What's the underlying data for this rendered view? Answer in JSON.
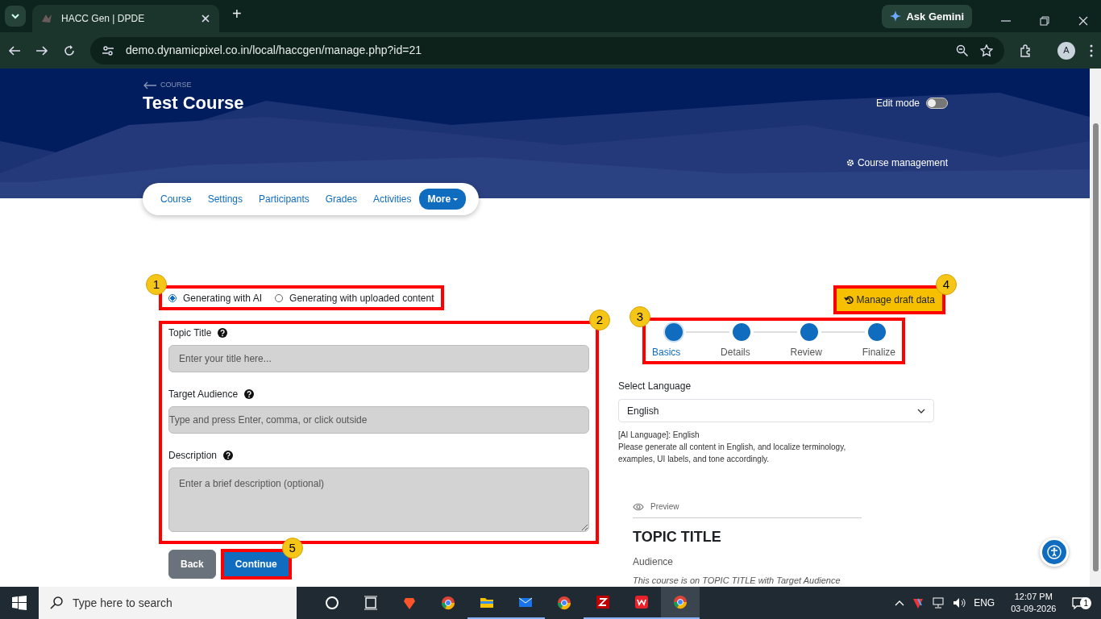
{
  "browser": {
    "tab_title": "HACC Gen | DPDE",
    "new_tab": "+",
    "ask_gemini": "Ask Gemini",
    "url": "demo.dynamicpixel.co.in/local/haccgen/manage.php?id=21",
    "profile": "A"
  },
  "header": {
    "back_label": "COURSE",
    "title": "Test Course",
    "edit_mode": {
      "label": "Edit mode",
      "on": false
    },
    "course_management": "Course management"
  },
  "course_nav": [
    {
      "label": "Course",
      "selected": false
    },
    {
      "label": "Settings",
      "selected": false
    },
    {
      "label": "Participants",
      "selected": false
    },
    {
      "label": "Grades",
      "selected": false
    },
    {
      "label": "Activities",
      "selected": false
    },
    {
      "label": "More",
      "selected": true
    }
  ],
  "mode_options": {
    "annotation": {
      "number": "1"
    },
    "items": [
      {
        "label": "Generating with AI",
        "selected": true
      },
      {
        "label": "Generating with uploaded content",
        "selected": false
      }
    ]
  },
  "form": {
    "annotation": {
      "number": "2"
    },
    "fields": [
      {
        "kind": "input",
        "label": "Topic Title",
        "placeholder": "Enter your title here..."
      },
      {
        "kind": "input",
        "label": "Target Audience",
        "placeholder": "Type and press Enter, comma, or click outside"
      },
      {
        "kind": "textarea",
        "label": "Description",
        "placeholder": "Enter a brief description (optional)"
      }
    ]
  },
  "actions": {
    "back": "Back",
    "continue": {
      "label": "Continue",
      "annotation": {
        "number": "5"
      }
    }
  },
  "draft_button": {
    "label": "Manage draft data",
    "annotation": {
      "number": "4"
    }
  },
  "steps": {
    "annotation": {
      "number": "3"
    },
    "items": [
      {
        "label": "Basics",
        "selected": true
      },
      {
        "label": "Details",
        "selected": false
      },
      {
        "label": "Review",
        "selected": false
      },
      {
        "label": "Finalize",
        "selected": false
      }
    ]
  },
  "language": {
    "label": "Select Language",
    "value": "English",
    "note_title": "[AI Language]: English",
    "note": "Please generate all content in English, and localize terminology, examples, UI labels, and tone accordingly."
  },
  "preview": {
    "label": "Preview",
    "title": "TOPIC TITLE",
    "audience": "Audience",
    "summary": "This course is on TOPIC TITLE with Target Audience"
  },
  "taskbar": {
    "search_placeholder": "Type here to search",
    "language": "ENG",
    "time": "12:07 PM",
    "date": "03-09-2026",
    "notifications": "1"
  }
}
